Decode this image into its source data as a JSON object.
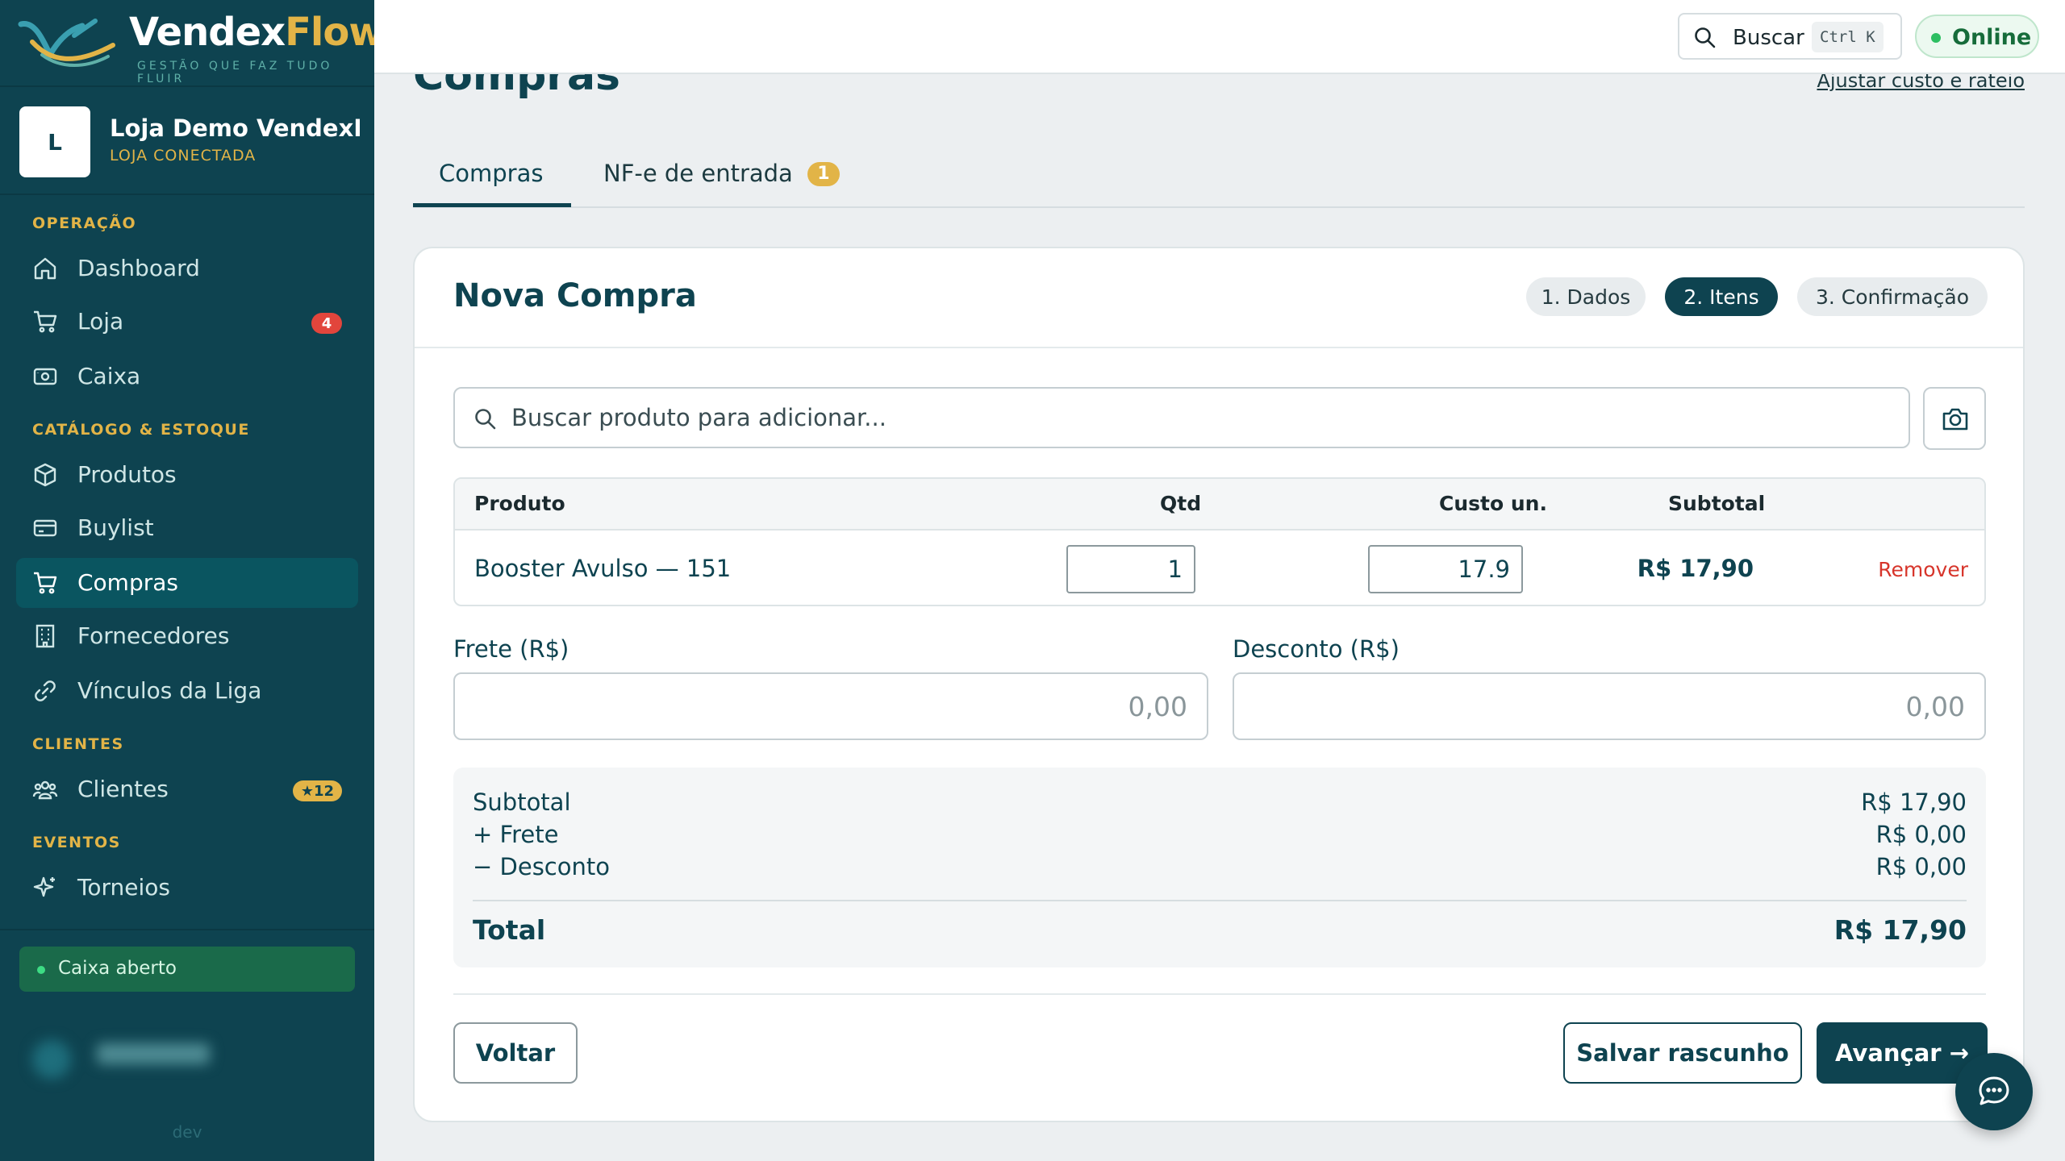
{
  "brand": {
    "name_main": "Vendex",
    "name_accent": "Flow",
    "tagline": "GESTÃO QUE FAZ TUDO FLUIR"
  },
  "store": {
    "initial": "L",
    "name": "Loja Demo VendexFl...",
    "status": "LOJA CONECTADA"
  },
  "nav": {
    "section_operacao": "OPERAÇÃO",
    "dashboard": "Dashboard",
    "loja": "Loja",
    "loja_badge": "4",
    "caixa": "Caixa",
    "section_catalogo": "CATÁLOGO & ESTOQUE",
    "produtos": "Produtos",
    "buylist": "Buylist",
    "compras": "Compras",
    "fornecedores": "Fornecedores",
    "vinculos": "Vínculos da Liga",
    "section_clientes": "CLIENTES",
    "clientes": "Clientes",
    "clientes_badge": "★12",
    "section_eventos": "EVENTOS",
    "torneios": "Torneios"
  },
  "cash_status": "Caixa aberto",
  "env": "dev",
  "topbar": {
    "search_label": "Buscar",
    "shortcut": "Ctrl K",
    "status": "Online"
  },
  "page": {
    "title": "Compras",
    "adjust_link": "Ajustar custo e rateio"
  },
  "tabs": [
    {
      "label": "Compras"
    },
    {
      "label": "NF-e de entrada",
      "count": "1"
    }
  ],
  "form": {
    "title": "Nova Compra",
    "steps": [
      "1. Dados",
      "2. Itens",
      "3. Confirmação"
    ],
    "active_step": 2,
    "search_placeholder": "Buscar produto para adicionar...",
    "table": {
      "headers": {
        "product": "Produto",
        "qty": "Qtd",
        "unit_cost": "Custo un.",
        "subtotal": "Subtotal"
      },
      "rows": [
        {
          "product": "Booster Avulso — 151",
          "qty": "1",
          "unit_cost": "17.9",
          "subtotal": "R$ 17,90",
          "remove": "Remover"
        }
      ]
    },
    "freight_label": "Frete (R$)",
    "freight_placeholder": "0,00",
    "discount_label": "Desconto (R$)",
    "discount_placeholder": "0,00",
    "summary": {
      "subtotal_label": "Subtotal",
      "subtotal_value": "R$ 17,90",
      "freight_label": "+ Frete",
      "freight_value": "R$ 0,00",
      "discount_label": "− Desconto",
      "discount_value": "R$ 0,00",
      "total_label": "Total",
      "total_value": "R$ 17,90"
    },
    "buttons": {
      "back": "Voltar",
      "save_draft": "Salvar rascunho",
      "next": "Avançar →"
    }
  },
  "colors": {
    "primary": "#0e4350",
    "accent": "#e2b447",
    "danger": "#d7352b",
    "online": "#2dbf62"
  }
}
